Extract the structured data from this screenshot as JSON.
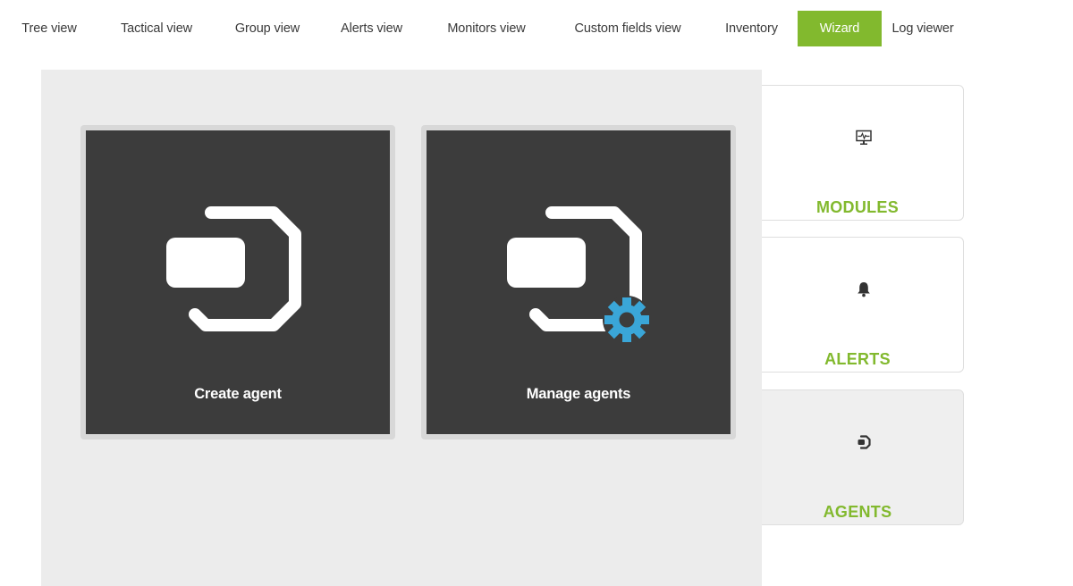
{
  "nav": {
    "tabs": [
      {
        "label": "Tree view"
      },
      {
        "label": "Tactical view"
      },
      {
        "label": "Group view"
      },
      {
        "label": "Alerts view"
      },
      {
        "label": "Monitors view"
      },
      {
        "label": "Custom fields view"
      },
      {
        "label": "Inventory"
      },
      {
        "label": "Wizard",
        "active": true
      },
      {
        "label": "Log viewer"
      }
    ]
  },
  "wizard": {
    "actions": [
      {
        "label": "Create agent",
        "icon": "agent-icon"
      },
      {
        "label": "Manage agents",
        "icon": "agent-gear-icon"
      }
    ],
    "menu": [
      {
        "label": "MODULES",
        "icon": "monitor-pulse-icon"
      },
      {
        "label": "ALERTS",
        "icon": "bell-icon"
      },
      {
        "label": "AGENTS",
        "icon": "agent-small-icon",
        "selected": true
      }
    ]
  },
  "colors": {
    "accent": "#82b92e",
    "tile": "#3c3c3c",
    "panel": "#ececec",
    "gear": "#3aa6d8"
  }
}
